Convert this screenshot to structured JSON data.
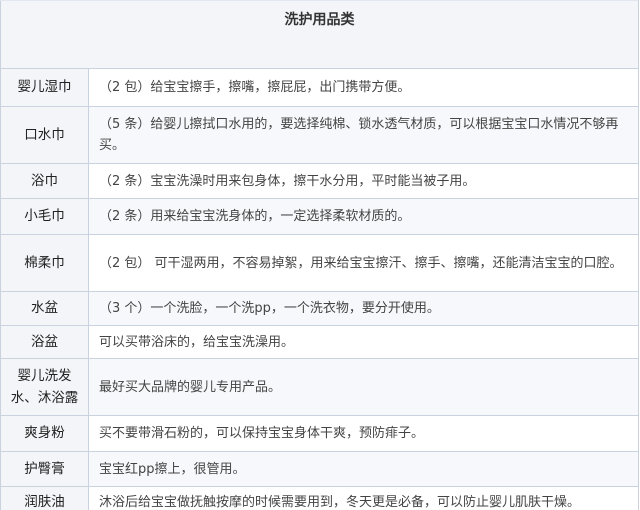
{
  "table": {
    "title": "洗护用品类",
    "rows": [
      {
        "name": "婴儿湿巾",
        "desc": "（2 包）给宝宝擦手，擦嘴，擦屁屁，出门携带方便。"
      },
      {
        "name": "口水巾",
        "desc": "（5 条）给婴儿擦拭口水用的，要选择纯棉、锁水透气材质，可以根据宝宝口水情况不够再买。"
      },
      {
        "name": "浴巾",
        "desc": "（2 条）宝宝洗澡时用来包身体，擦干水分用，平时能当被子用。"
      },
      {
        "name": "小毛巾",
        "desc": "（2 条）用来给宝宝洗身体的，一定选择柔软材质的。"
      },
      {
        "name": "棉柔巾",
        "desc": "（2 包） 可干湿两用，不容易掉絮，用来给宝宝擦汗、擦手、擦嘴，还能清洁宝宝的口腔。"
      },
      {
        "name": "水盆",
        "desc": "（3 个）一个洗脸，一个洗pp，一个洗衣物，要分开使用。"
      },
      {
        "name": "浴盆",
        "desc": "可以买带浴床的，给宝宝洗澡用。"
      },
      {
        "name": "婴儿洗发水、沐浴露",
        "desc": "最好买大品牌的婴儿专用产品。"
      },
      {
        "name": "爽身粉",
        "desc": "买不要带滑石粉的，可以保持宝宝身体干爽，预防痱子。"
      },
      {
        "name": "护臀膏",
        "desc": "宝宝红pp擦上，很管用。"
      },
      {
        "name": "润肤油",
        "desc": "沐浴后给宝宝做抚触按摩的时候需要用到，冬天更是必备，可以防止婴儿肌肤干燥。"
      }
    ]
  }
}
